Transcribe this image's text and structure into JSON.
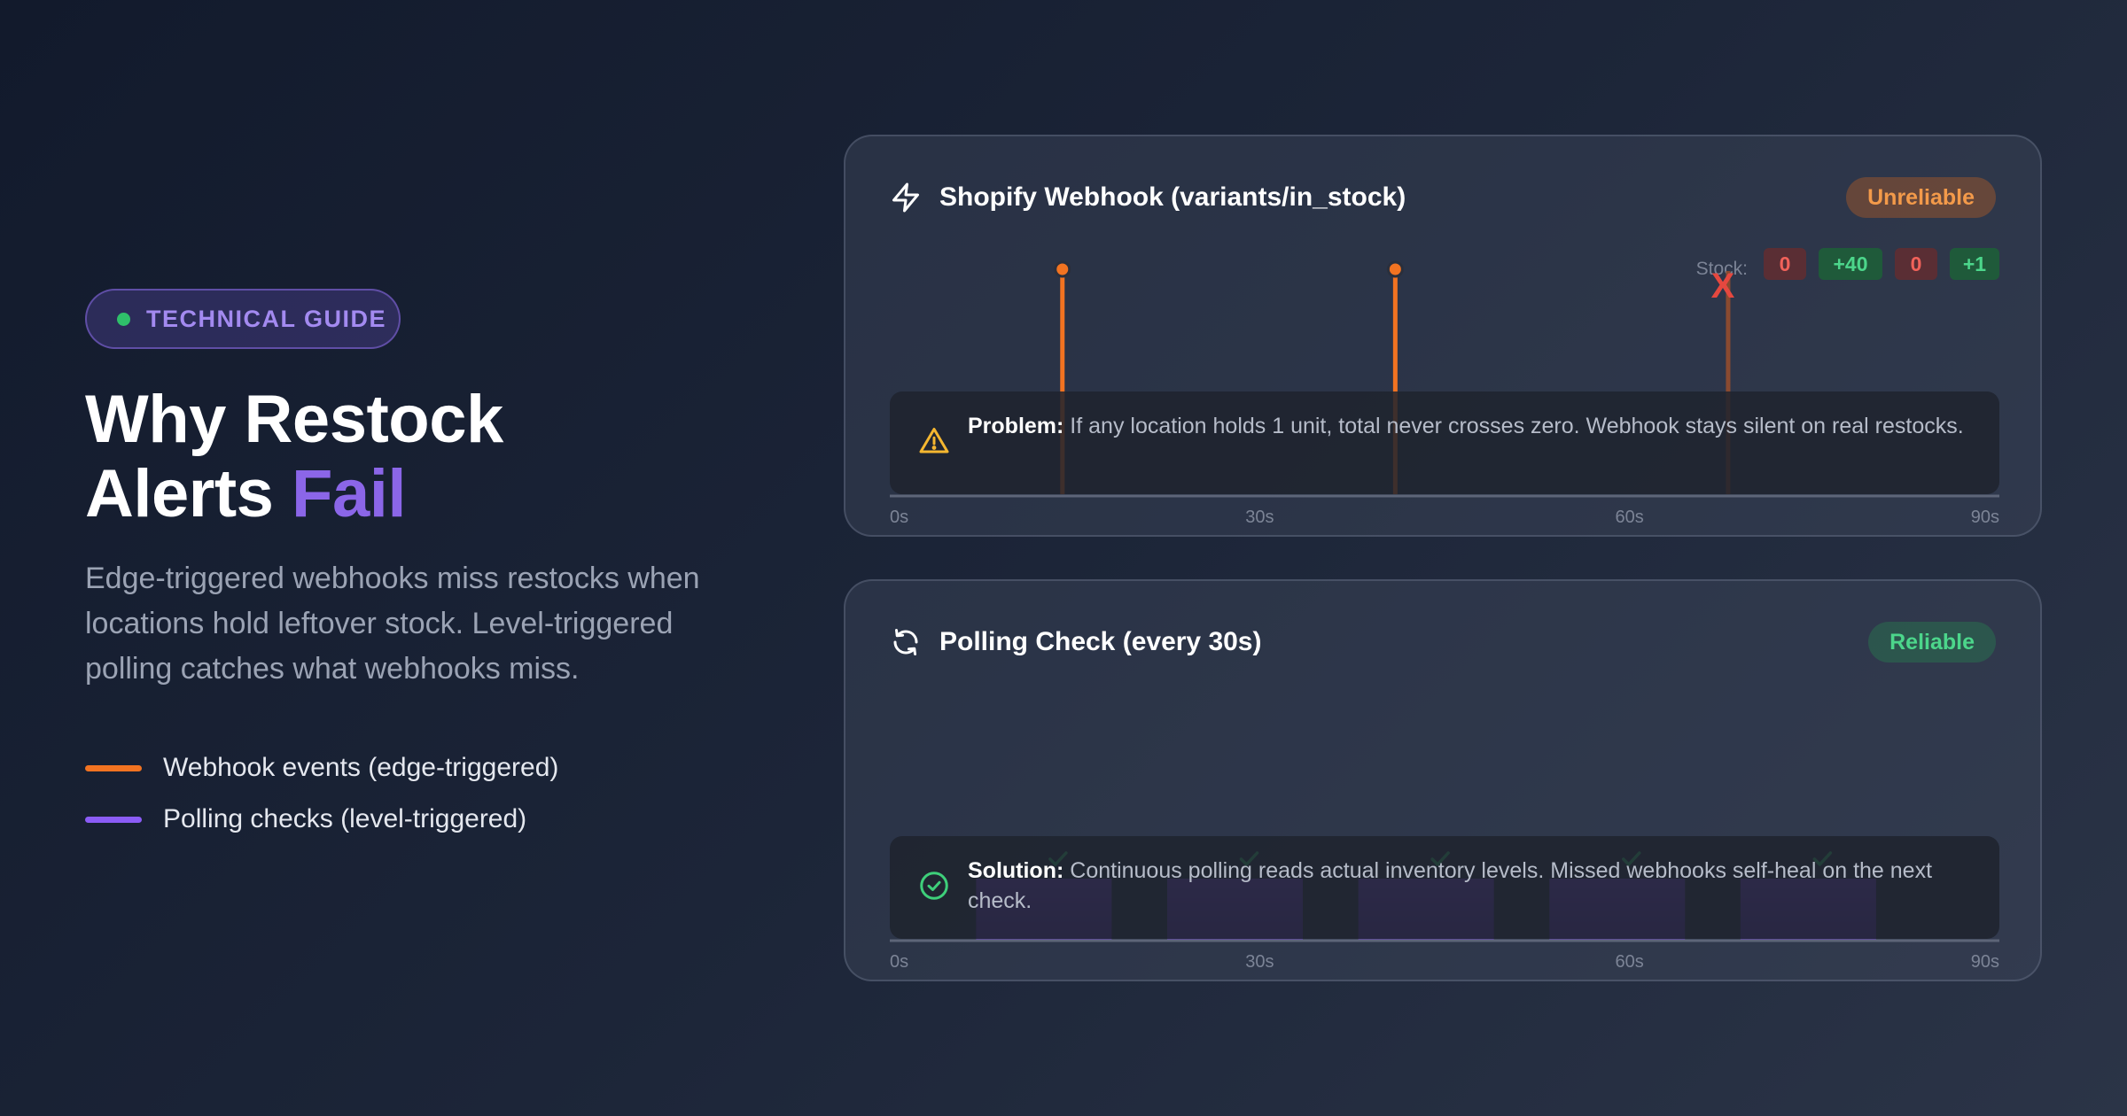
{
  "badge": {
    "label": "TECHNICAL GUIDE"
  },
  "title": {
    "line1": "Why Restock",
    "line2_plain": "Alerts",
    "line2_accent": "Fail"
  },
  "subtitle": "Edge-triggered webhooks miss restocks when locations hold leftover stock. Level-triggered polling catches what webhooks miss.",
  "legend": [
    {
      "label": "Webhook events (edge-triggered)",
      "color": "#f27321"
    },
    {
      "label": "Polling checks (level-triggered)",
      "color": "#8b5cf6"
    }
  ],
  "webhook_card": {
    "icon": "lightning-icon",
    "title": "Shopify Webhook (variants/in_stock)",
    "status": "Unreliable",
    "stock_label": "Stock:",
    "stock_values": [
      {
        "text": "0",
        "kind": "zero"
      },
      {
        "text": "+40",
        "kind": "positive"
      },
      {
        "text": "0",
        "kind": "zero"
      },
      {
        "text": "+1",
        "kind": "positive"
      }
    ],
    "missed_marker": "X",
    "info_label": "Problem:",
    "info_text": " If any location holds 1 unit, total never crosses zero. Webhook stays silent on real restocks."
  },
  "polling_card": {
    "icon": "refresh-icon",
    "title": "Polling Check (every 30s)",
    "status": "Reliable",
    "info_label": "Solution:",
    "info_text": " Continuous polling reads actual inventory levels. Missed webhooks self-heal on the next check."
  },
  "chart_data": [
    {
      "type": "timeline",
      "x_ticks": [
        "0s",
        "30s",
        "60s",
        "90s"
      ],
      "xlim": [
        0,
        90
      ],
      "events": [
        {
          "t": 14,
          "delivered": true
        },
        {
          "t": 41,
          "delivered": true
        },
        {
          "t": 68,
          "delivered": false
        }
      ]
    },
    {
      "type": "bar",
      "x_ticks": [
        "0s",
        "30s",
        "60s",
        "90s"
      ],
      "xlim": [
        0,
        90
      ],
      "checks": [
        {
          "start": 7,
          "end": 18,
          "ok": true
        },
        {
          "start": 22.5,
          "end": 33.5,
          "ok": true
        },
        {
          "start": 38,
          "end": 49,
          "ok": true
        },
        {
          "start": 53.5,
          "end": 64.5,
          "ok": true
        },
        {
          "start": 69,
          "end": 80,
          "ok": true
        }
      ]
    }
  ],
  "colors": {
    "accent": "#8b66e8",
    "webhook": "#f27321",
    "poll": "#8b5cf6",
    "ok": "#3ecf7a",
    "error": "#e5483f"
  }
}
